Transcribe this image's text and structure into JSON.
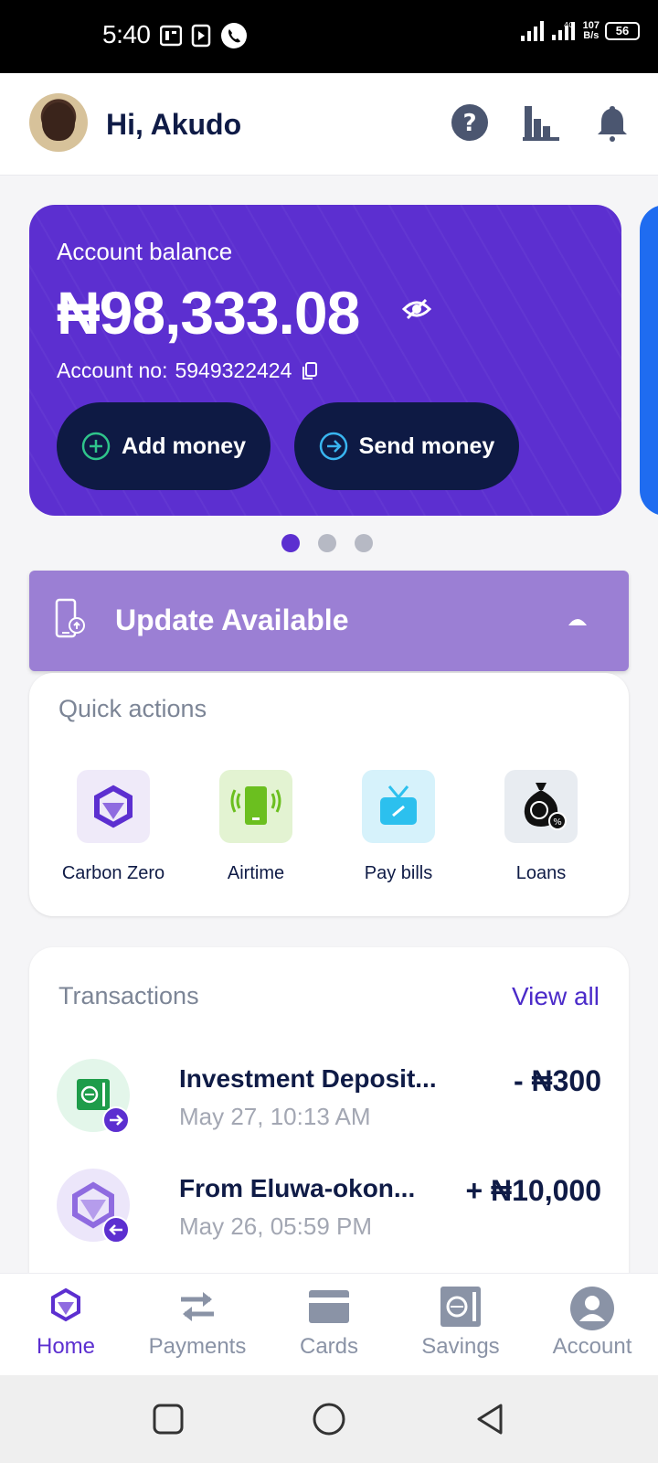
{
  "status_bar": {
    "time": "5:40",
    "network_speed_value": "107",
    "network_speed_unit": "B/s",
    "battery": "56",
    "network_type": "4G"
  },
  "header": {
    "greeting": "Hi, Akudo",
    "icons": [
      "help-icon",
      "chart-icon",
      "bell-icon"
    ]
  },
  "balance_card": {
    "label": "Account balance",
    "amount": "₦98,333.08",
    "account_no_label": "Account no:",
    "account_no": "5949322424",
    "add_money_label": "Add money",
    "send_money_label": "Send money",
    "accent": "#5c2fd0"
  },
  "carousel": {
    "count": 3,
    "active_index": 0
  },
  "update_banner": {
    "text": "Update Available"
  },
  "quick_actions": {
    "title": "Quick actions",
    "items": [
      {
        "label": "Carbon Zero",
        "icon": "carbon-zero-icon"
      },
      {
        "label": "Airtime",
        "icon": "airtime-icon"
      },
      {
        "label": "Pay bills",
        "icon": "tv-bills-icon"
      },
      {
        "label": "Loans",
        "icon": "money-bag-icon"
      }
    ]
  },
  "transactions": {
    "title": "Transactions",
    "view_all": "View all",
    "items": [
      {
        "title": "Investment Deposit...",
        "date": "May 27, 10:13 AM",
        "amount": "- ₦300",
        "direction": "out"
      },
      {
        "title": "From Eluwa-okon...",
        "date": "May 26, 05:59 PM",
        "amount": "+ ₦10,000",
        "direction": "in"
      }
    ]
  },
  "bottom_nav": {
    "items": [
      {
        "label": "Home",
        "active": true
      },
      {
        "label": "Payments",
        "active": false
      },
      {
        "label": "Cards",
        "active": false
      },
      {
        "label": "Savings",
        "active": false
      },
      {
        "label": "Account",
        "active": false
      }
    ]
  }
}
